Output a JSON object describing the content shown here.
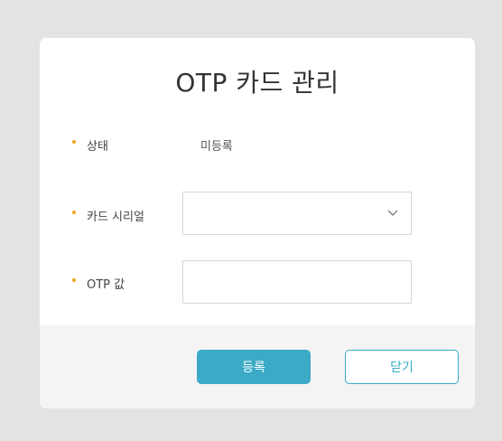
{
  "modal": {
    "title": "OTP 카드 관리",
    "status": {
      "label": "상태",
      "value": "미등록"
    },
    "card_serial": {
      "label": "카드 시리얼",
      "value": ""
    },
    "otp": {
      "label": "OTP 값",
      "value": "",
      "placeholder": ""
    },
    "buttons": {
      "register": "등록",
      "close": "닫기"
    }
  },
  "colors": {
    "accent": "#3aaac6",
    "bullet": "#f2a81d",
    "backdrop": "#e3e3e3",
    "footer": "#f4f4f4"
  },
  "icons": {
    "select_arrow": "chevron-down-icon"
  }
}
